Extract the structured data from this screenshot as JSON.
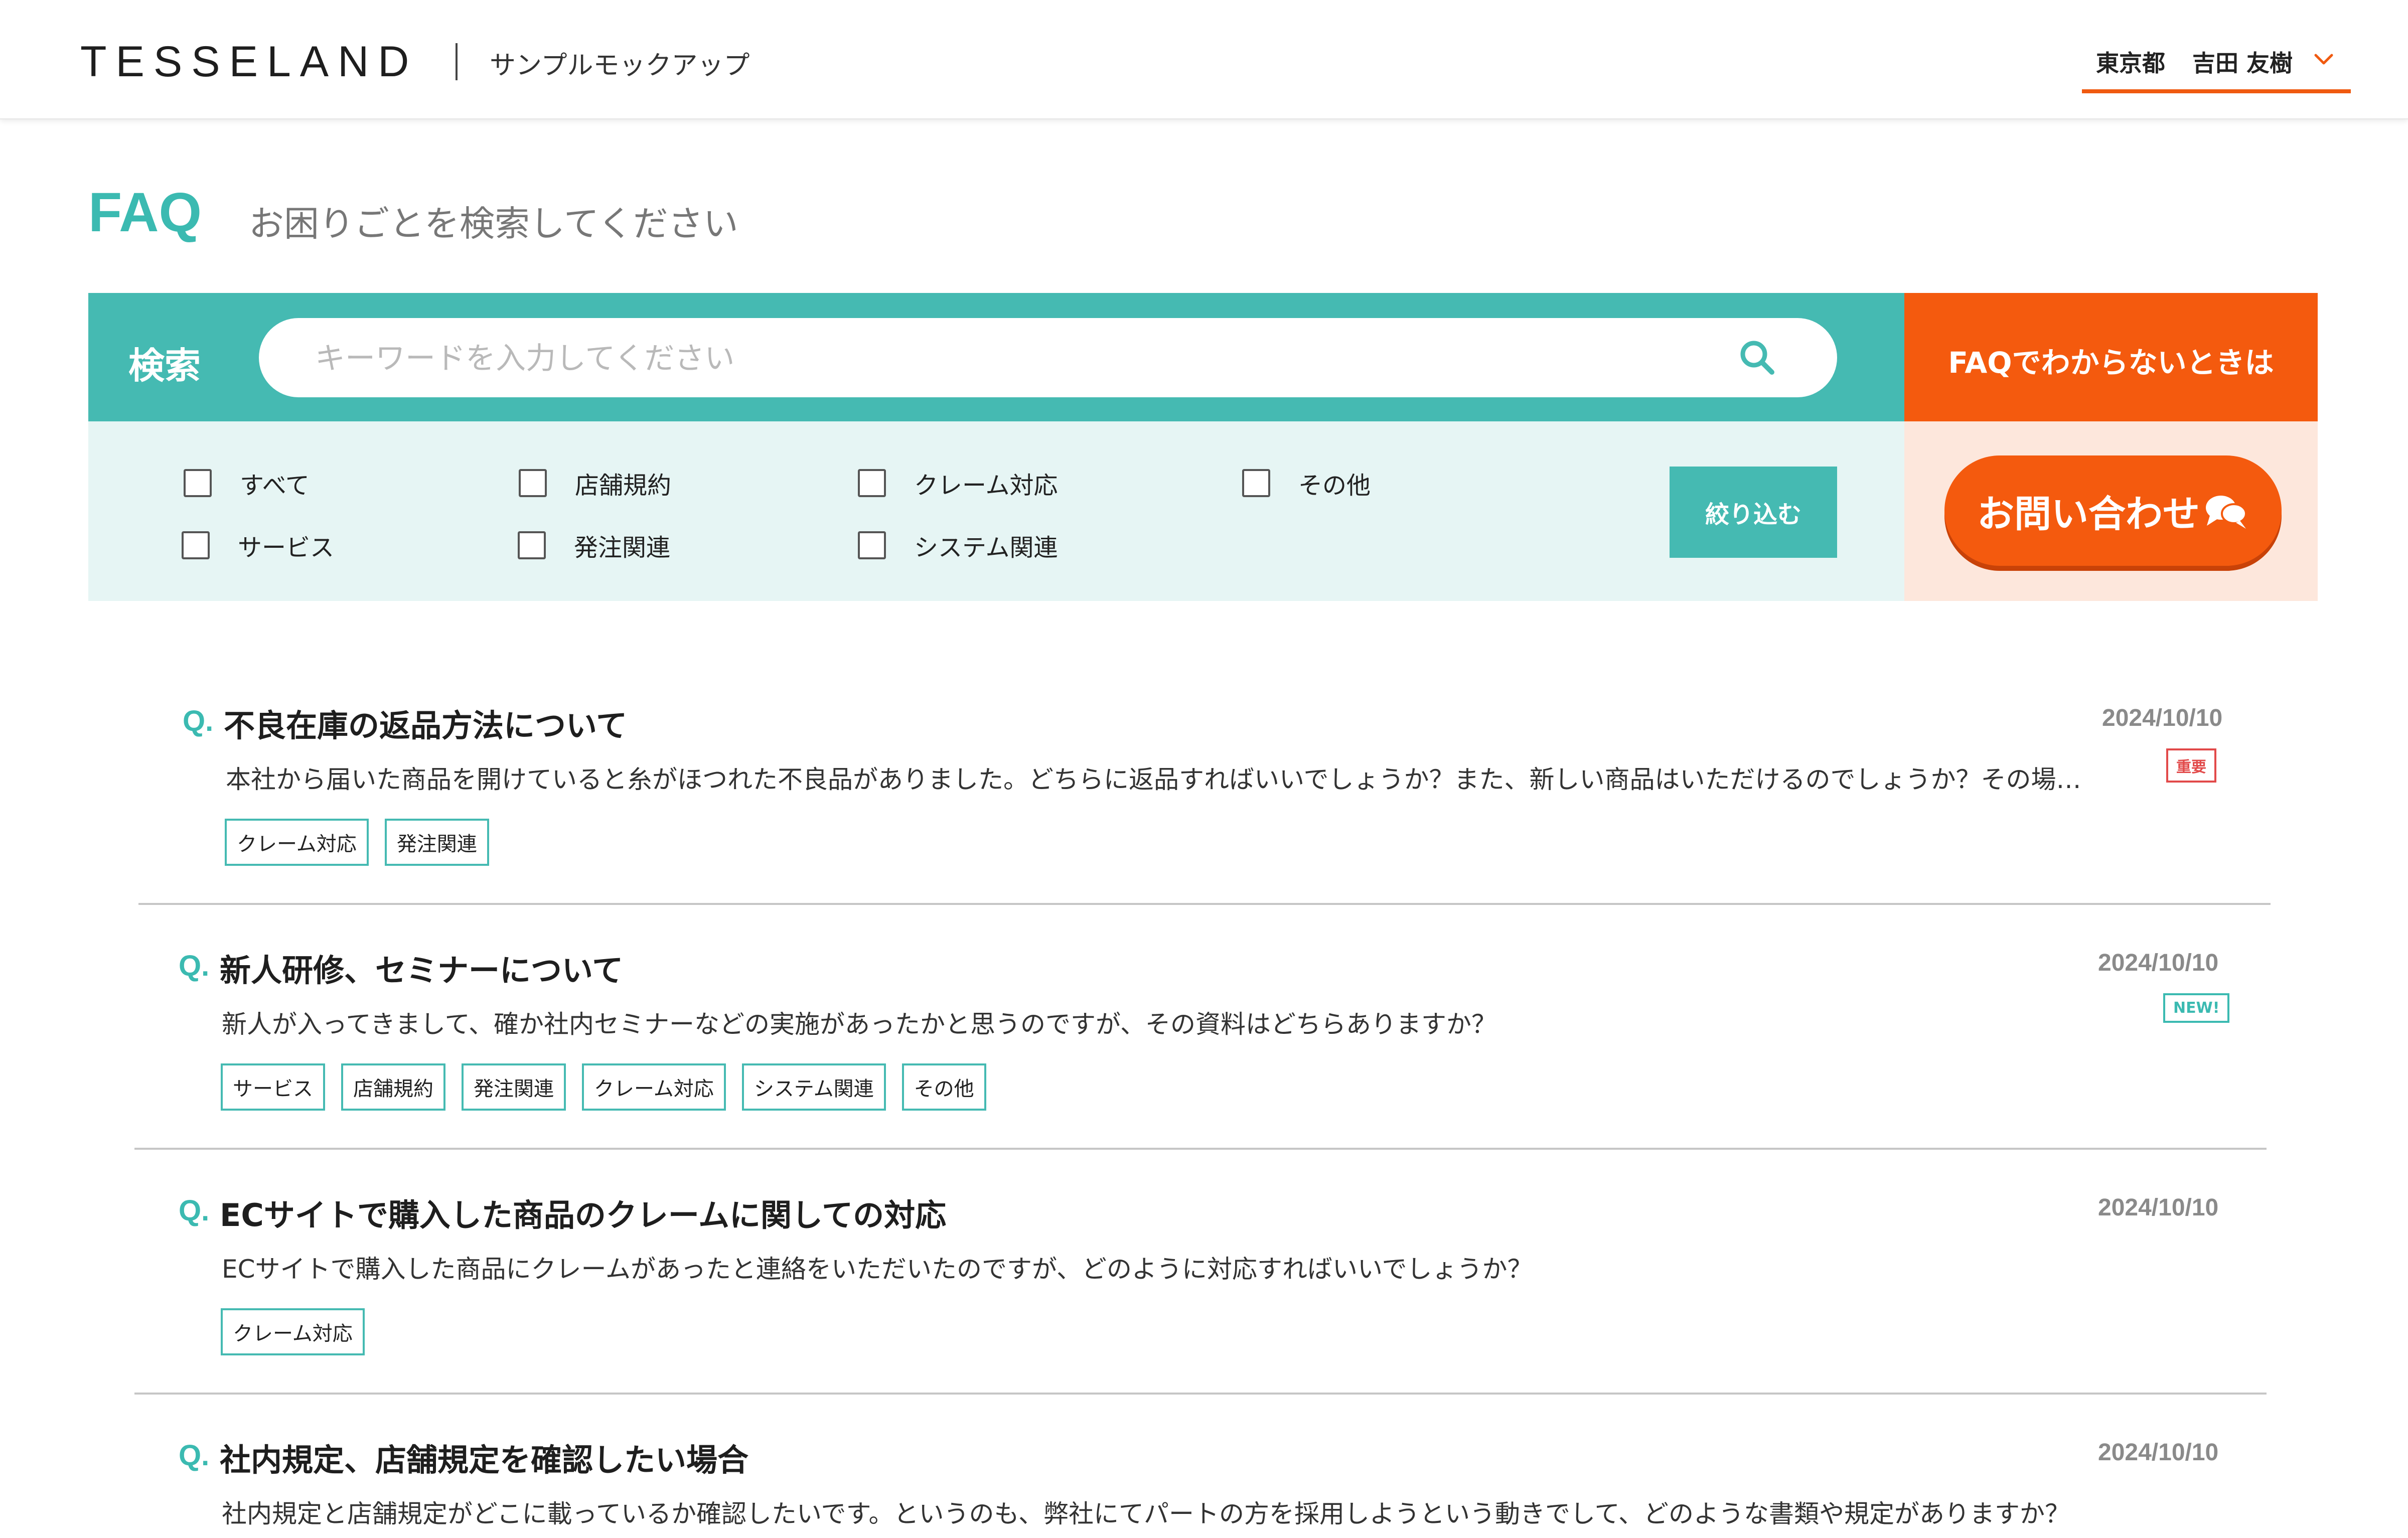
{
  "header": {
    "logo": "TESSELAND",
    "subtitle": "サンプルモックアップ",
    "user": {
      "prefecture": "東京都",
      "name": "吉田 友樹"
    }
  },
  "page": {
    "title": "FAQ",
    "subtitle": "お困りごとを検索してください"
  },
  "search": {
    "label": "検索",
    "placeholder": "キーワードを入力してください",
    "value": ""
  },
  "nofaq": {
    "label": "FAQでわからないときは"
  },
  "filters": {
    "items": [
      {
        "label": "すべて",
        "checked": false
      },
      {
        "label": "店舗規約",
        "checked": false
      },
      {
        "label": "クレーム対応",
        "checked": false
      },
      {
        "label": "その他",
        "checked": false
      },
      {
        "label": "サービス",
        "checked": false
      },
      {
        "label": "発注関連",
        "checked": false
      },
      {
        "label": "システム関連",
        "checked": false
      }
    ],
    "apply_label": "絞り込む"
  },
  "contact": {
    "label": "お問い合わせ"
  },
  "colors": {
    "teal": "#45bab2",
    "orange": "#f45a0e",
    "light_teal": "#e6f5f4",
    "light_orange": "#fde7dc",
    "important_red": "#e24a4a"
  },
  "faqs": [
    {
      "q": "Q.",
      "title": "不良在庫の返品方法について",
      "date": "2024/10/10",
      "badge": "重要",
      "excerpt": "本社から届いた商品を開けていると糸がほつれた不良品がありました。どちらに返品すればいいでしょうか？また、新しい商品はいただけるのでしょうか？その場合の在庫管…",
      "tags": [
        "クレーム対応",
        "発注関連"
      ]
    },
    {
      "q": "Q.",
      "title": "新人研修、セミナーについて",
      "date": "2024/10/10",
      "badge": "NEW!",
      "excerpt": "新人が入ってきまして、確か社内セミナーなどの実施があったかと思うのですが、その資料はどちらありますか？",
      "tags": [
        "サービス",
        "店舗規約",
        "発注関連",
        "クレーム対応",
        "システム関連",
        "その他"
      ]
    },
    {
      "q": "Q.",
      "title": "ECサイトで購入した商品のクレームに関しての対応",
      "date": "2024/10/10",
      "excerpt": "ECサイトで購入した商品にクレームがあったと連絡をいただいたのですが、どのように対応すればいいでしょうか？",
      "tags": [
        "クレーム対応"
      ]
    },
    {
      "q": "Q.",
      "title": "社内規定、店舗規定を確認したい場合",
      "date": "2024/10/10",
      "excerpt": "社内規定と店舗規定がどこに載っているか確認したいです。というのも、弊社にてパートの方を採用しようという動きでして、どのような書類や規定がありますか？"
    }
  ]
}
